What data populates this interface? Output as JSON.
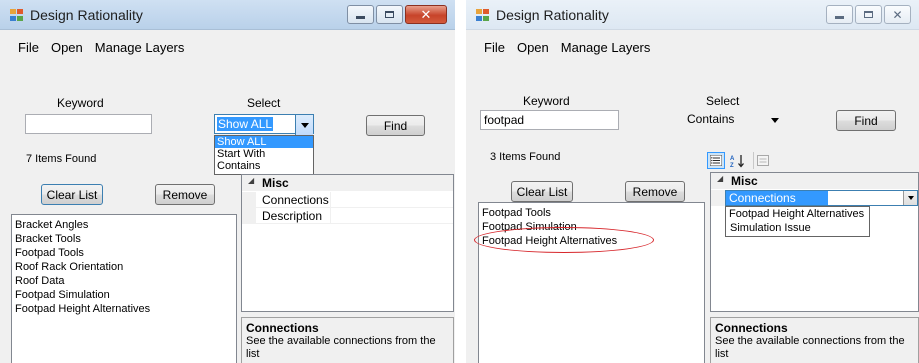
{
  "left_window": {
    "title": "Design Rationality",
    "menu": [
      "File",
      "Open",
      "Manage Layers"
    ],
    "keyword_label": "Keyword",
    "keyword_value": "",
    "select_label": "Select",
    "select_value": "Show ALL",
    "find_label": "Find",
    "dropdown_options": [
      "Show ALL",
      "Start With",
      "Contains"
    ],
    "items_found": "7 Items Found",
    "clear_list_label": "Clear List",
    "remove_label": "Remove",
    "items": [
      "Bracket Angles",
      "Bracket Tools",
      "Footpad Tools",
      "Roof Rack Orientation",
      "Roof Data",
      "Footpad Simulation",
      "Footpad Height Alternatives"
    ],
    "property_category": "Misc",
    "properties": [
      "Connections",
      "Description"
    ],
    "description_title": "Connections",
    "description_text": "See the available connections from the list"
  },
  "right_window": {
    "title": "Design Rationality",
    "menu": [
      "File",
      "Open",
      "Manage Layers"
    ],
    "keyword_label": "Keyword",
    "keyword_value": "footpad",
    "select_label": "Select",
    "select_value": "Contains",
    "find_label": "Find",
    "items_found": "3 Items Found",
    "clear_list_label": "Clear List",
    "remove_label": "Remove",
    "items": [
      "Footpad Tools",
      "Footpad Simulation",
      "Footpad Height Alternatives"
    ],
    "property_category": "Misc",
    "selected_property": "Connections",
    "connection_options": [
      "Footpad Height Alternatives",
      "Simulation Issue"
    ],
    "description_title": "Connections",
    "description_text": "See the available connections from the list"
  },
  "colors": {
    "selection": "#3399ff",
    "annotation_ellipse": "#d7262b",
    "left_titlebar": "#b9d1ea",
    "right_titlebar": "#dde8f3",
    "close_button": "#c7442a"
  },
  "icons": [
    "app-icon",
    "minimize-icon",
    "maximize-icon",
    "close-icon",
    "categorized-icon",
    "alphabetical-icon",
    "property-pages-icon",
    "expand-arrow-icon",
    "dropdown-arrow-icon"
  ]
}
